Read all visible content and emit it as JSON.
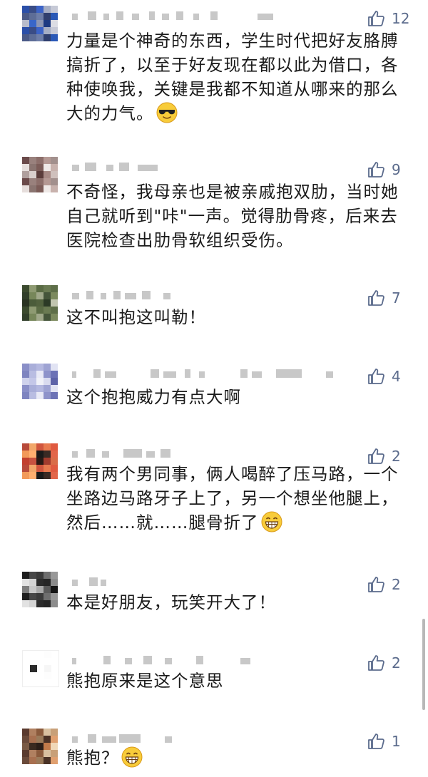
{
  "comments": [
    {
      "text": "力量是个神奇的东西，学生时代把好友胳膊搞折了，以至于好友现在都以此为借口，各种使唤我，关键是我都不知道从哪来的那么大的力气。",
      "likes": "12",
      "emoji": "sunglasses-emoji"
    },
    {
      "text": "不奇怪，我母亲也是被亲戚抱双肋，当时她自己就听到\"咔\"一声。觉得肋骨疼，后来去医院检查出肋骨软组织受伤。",
      "likes": "9"
    },
    {
      "text": "这不叫抱这叫勒！",
      "likes": "7"
    },
    {
      "text": "这个抱抱威力有点大啊",
      "likes": "4"
    },
    {
      "text": "我有两个男同事，俩人喝醉了压马路，一个坐路边马路牙子上了，另一个想坐他腿上，然后……就……腿骨折了",
      "likes": "2",
      "emoji": "grinning-emoji"
    },
    {
      "text": "本是好朋友，玩笑开大了！",
      "likes": "2"
    },
    {
      "text": "熊抱原来是这个意思",
      "likes": "2"
    },
    {
      "text": "熊抱？",
      "likes": "1",
      "emoji": "grinning-emoji"
    }
  ],
  "colors": {
    "like_icon": "#5b6b8c",
    "text": "#1a1a1a",
    "username_blur": "#c8c8c8"
  }
}
